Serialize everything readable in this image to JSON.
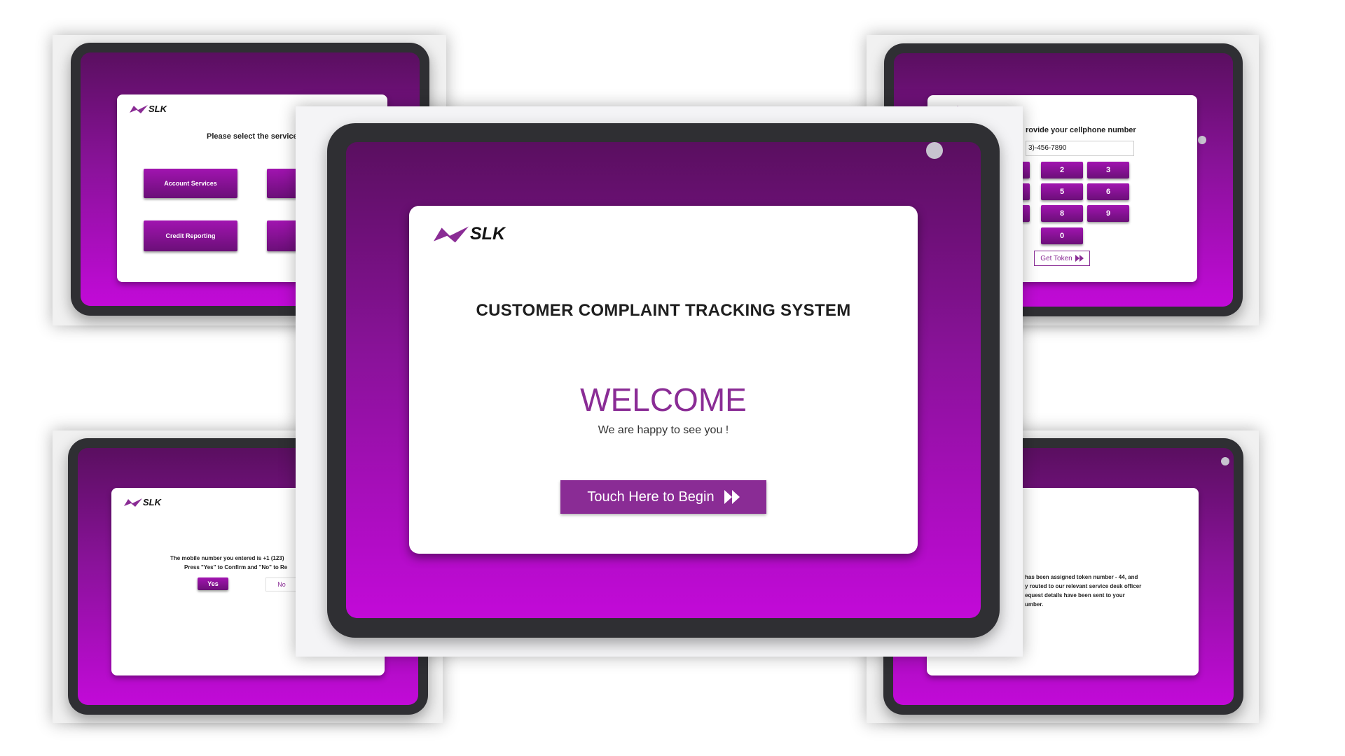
{
  "brand": {
    "name": "SLK",
    "accent": "#8a2c95"
  },
  "main": {
    "title": "CUSTOMER COMPLAINT TRACKING SYSTEM",
    "welcome": "WELCOME",
    "subtitle": "We are happy to see you !",
    "begin_label": "Touch Here to Begin"
  },
  "service_screen": {
    "prompt": "Please select the service!",
    "options": [
      "Account Services",
      "Credit Reporting"
    ]
  },
  "phone_screen": {
    "prompt": "rovide your cellphone number",
    "phone_value": "3)-456-7890",
    "keys": [
      "2",
      "3",
      "5",
      "6",
      "8",
      "9",
      "0"
    ],
    "token_label": "Get Token"
  },
  "confirm_screen": {
    "line1": "The mobile number you entered is +1 (123)",
    "line2": "Press \"Yes\" to Confirm and \"No\" to Re",
    "yes_label": "Yes",
    "no_label": "No"
  },
  "token_screen": {
    "line1": "has been assigned token number - 44, and",
    "line2": "y routed to our relevant service desk officer",
    "line3": "equest details have been sent to your",
    "line4": "umber."
  }
}
